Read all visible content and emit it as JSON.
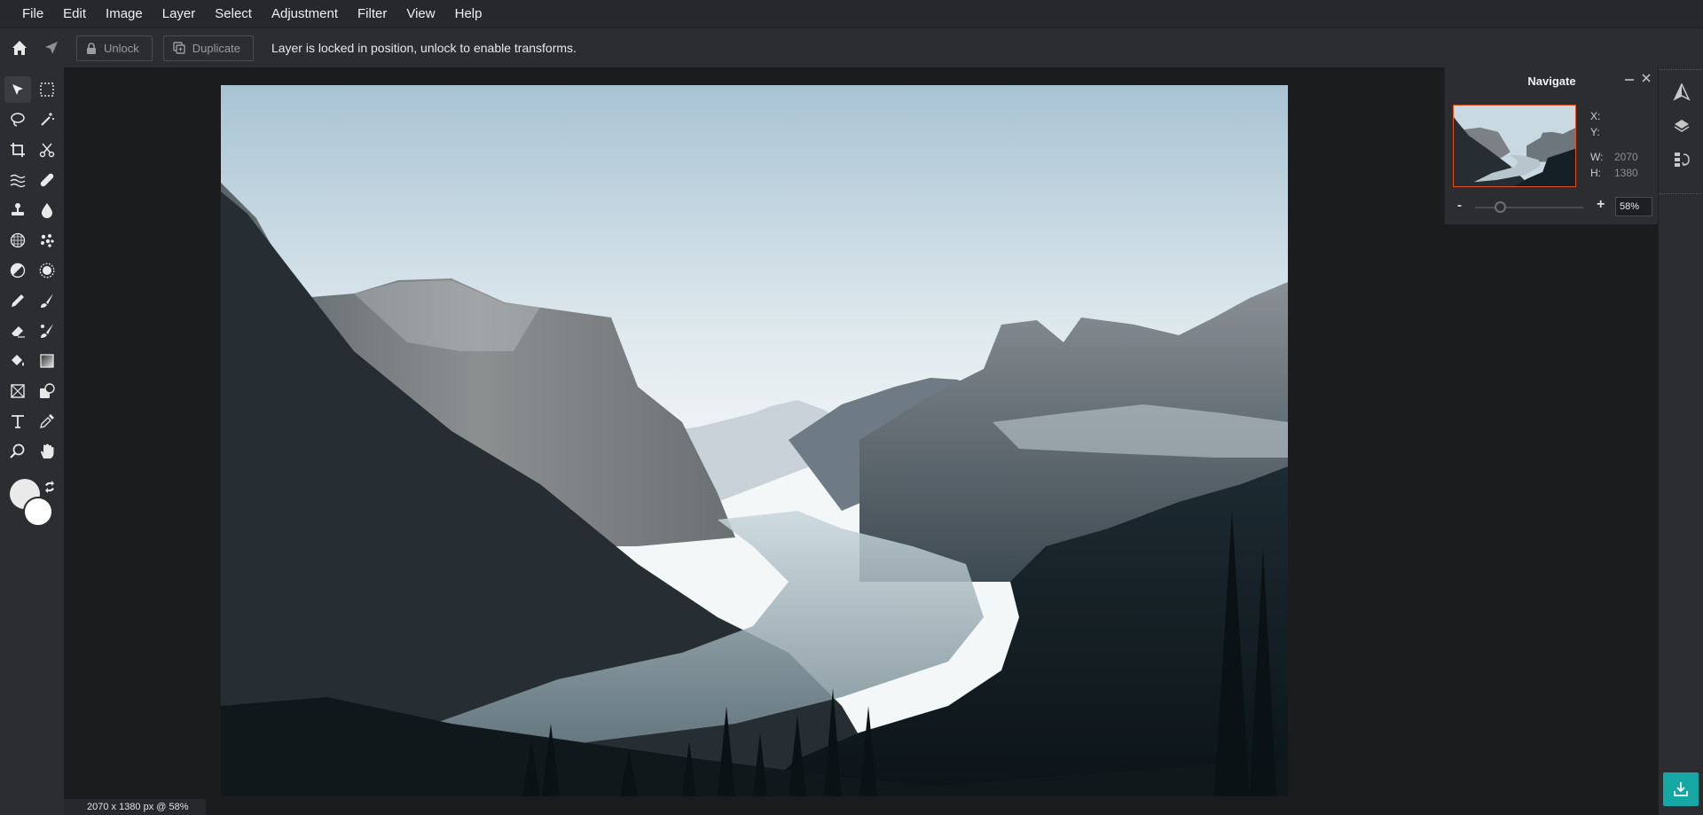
{
  "menu": [
    "File",
    "Edit",
    "Image",
    "Layer",
    "Select",
    "Adjustment",
    "Filter",
    "View",
    "Help"
  ],
  "toolbar": {
    "unlock_label": "Unlock",
    "duplicate_label": "Duplicate",
    "message": "Layer is locked in position, unlock to enable transforms."
  },
  "tools": [
    [
      "move-tool",
      "marquee-tool"
    ],
    [
      "lasso-tool",
      "magic-wand-tool"
    ],
    [
      "crop-tool",
      "cut-tool"
    ],
    [
      "liquify-tool",
      "heal-tool"
    ],
    [
      "clone-stamp-tool",
      "blur-tool"
    ],
    [
      "sponge-tool",
      "pattern-tool"
    ],
    [
      "dodge-tool",
      "burn-tool"
    ],
    [
      "pencil-tool",
      "brush-tool"
    ],
    [
      "eraser-tool",
      "color-replace-tool"
    ],
    [
      "paint-bucket-tool",
      "gradient-tool"
    ],
    [
      "shape-tool",
      "drawing-tool"
    ],
    [
      "text-tool",
      "eyedropper-tool"
    ],
    [
      "zoom-tool",
      "hand-tool"
    ]
  ],
  "colors": {
    "foreground": "#eaeaea",
    "background": "#ffffff",
    "accent": "#16a7a4",
    "thumb_border": "#e0501e"
  },
  "navigate": {
    "title": "Navigate",
    "x_label": "X:",
    "y_label": "Y:",
    "w_label": "W:",
    "h_label": "H:",
    "w_value": "2070",
    "h_value": "1380",
    "zoom_value": "58%",
    "zoom_minus": "-",
    "zoom_plus": "+",
    "zoom_level": 0.58
  },
  "status": {
    "text": "2070 x 1380 px @ 58%"
  },
  "right_panel_icons": [
    "navigate-icon",
    "layers-icon",
    "history-icon"
  ]
}
